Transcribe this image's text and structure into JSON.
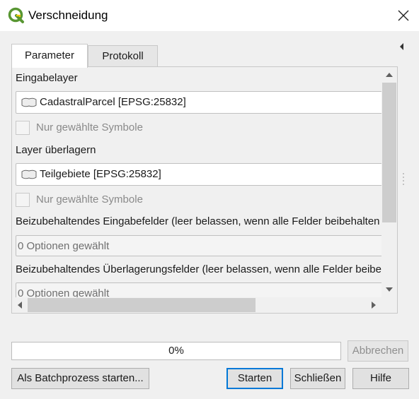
{
  "window": {
    "title": "Verschneidung",
    "icon": "qgis-logo-icon"
  },
  "tabs": [
    {
      "label": "Parameter",
      "active": true
    },
    {
      "label": "Protokoll",
      "active": false
    }
  ],
  "form": {
    "input_layer_label": "Eingabelayer",
    "input_layer_value": "CadastralParcel [EPSG:25832]",
    "input_selected_only_label": "Nur gewählte Symbole",
    "overlay_layer_label": "Layer überlagern",
    "overlay_layer_value": "Teilgebiete [EPSG:25832]",
    "overlay_selected_only_label": "Nur gewählte Symbole",
    "input_fields_label": "Beizubehaltendes Eingabefelder (leer belassen, wenn alle Felder beibehalten werden sollen)",
    "input_fields_value": "0 Optionen gewählt",
    "overlay_fields_label": "Beizubehaltendes Überlagerungsfelder (leer belassen, wenn alle Felder beibehalten werden sollen)",
    "overlay_fields_value": "0 Optionen gewählt"
  },
  "progress": {
    "text": "0%",
    "value": 0
  },
  "buttons": {
    "cancel": "Abbrechen",
    "batch": "Als Batchprozess starten...",
    "run": "Starten",
    "close": "Schließen",
    "help": "Hilfe"
  },
  "colors": {
    "qgis_green": "#589632",
    "qgis_yellow": "#eec90d",
    "default_button_border": "#0078d7"
  }
}
